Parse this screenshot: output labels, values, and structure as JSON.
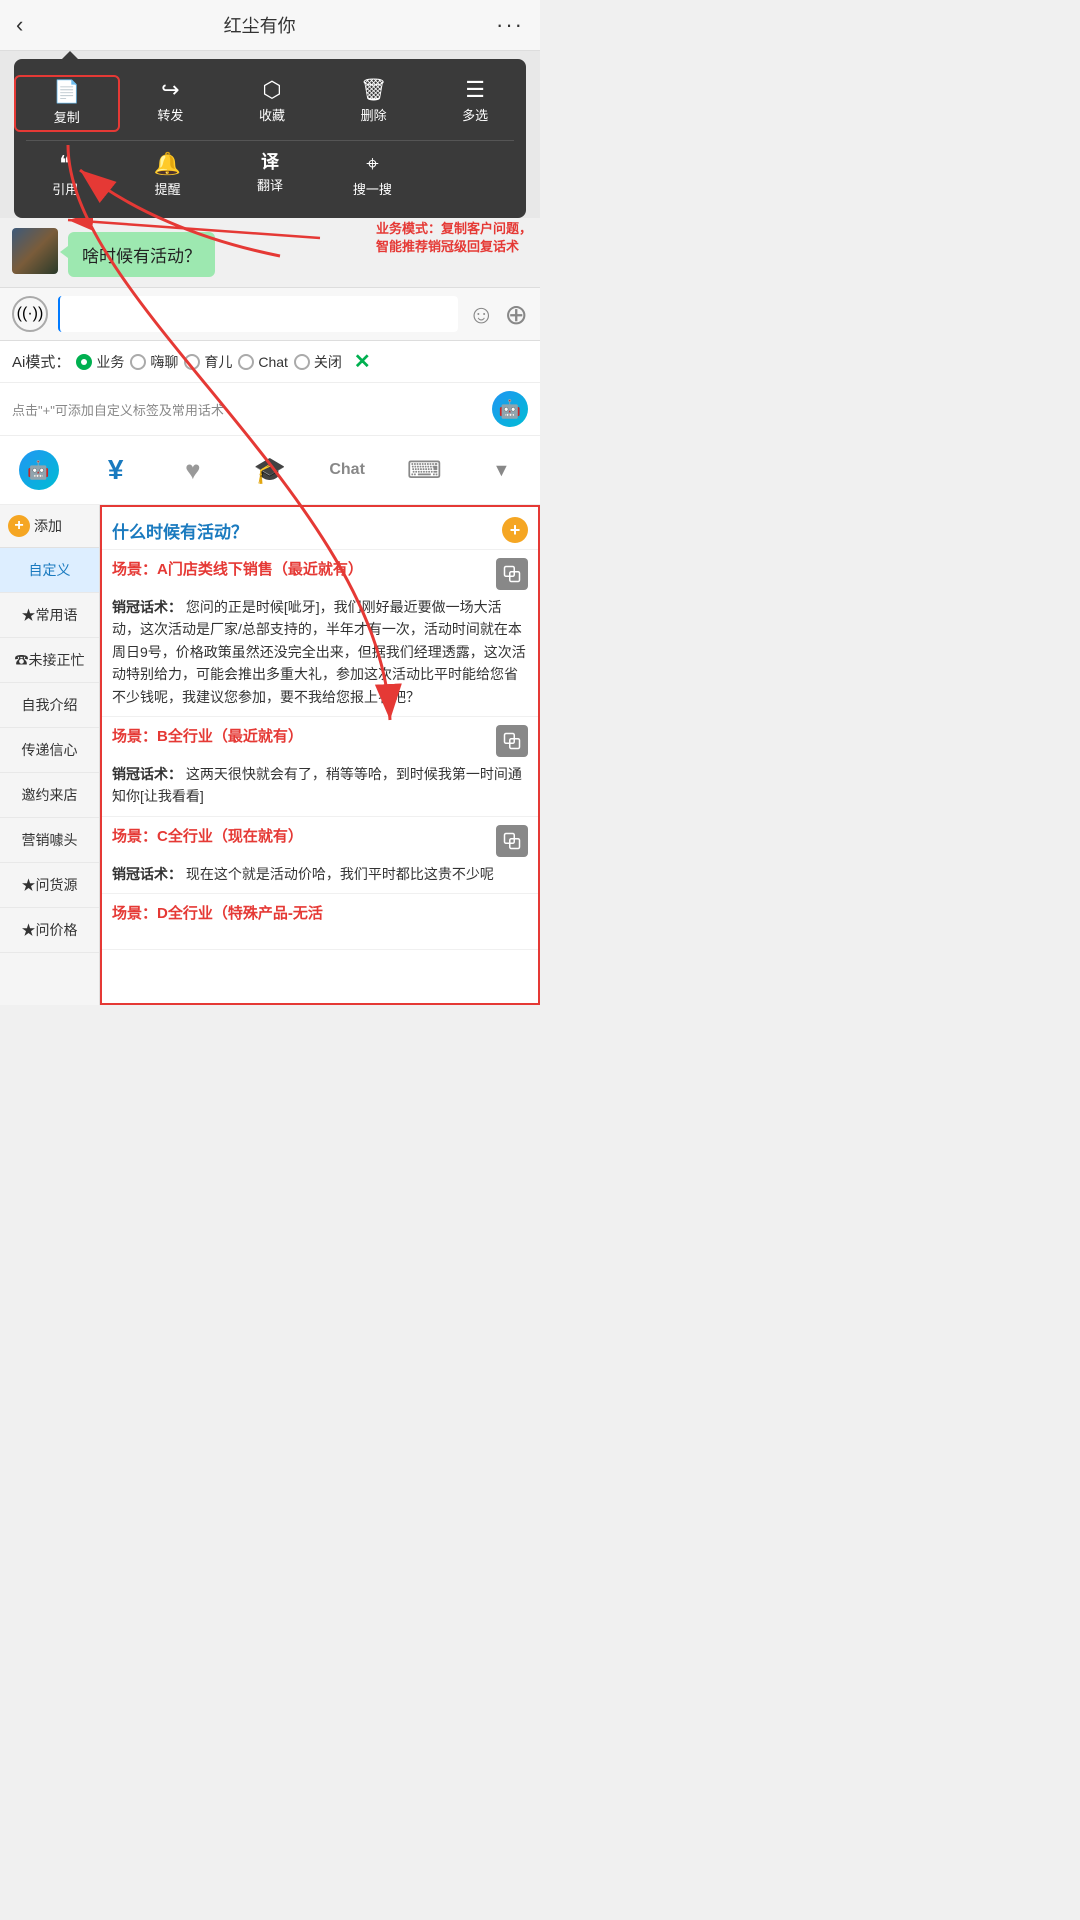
{
  "header": {
    "title": "红尘有你",
    "back_label": "‹",
    "more_label": "···"
  },
  "context_menu": {
    "row1": [
      {
        "icon": "📄",
        "label": "复制",
        "highlighted": true
      },
      {
        "icon": "↪",
        "label": "转发"
      },
      {
        "icon": "⬡",
        "label": "收藏"
      },
      {
        "icon": "🗑",
        "label": "删除"
      },
      {
        "icon": "☰",
        "label": "多选"
      }
    ],
    "row2": [
      {
        "icon": "❝",
        "label": "引用"
      },
      {
        "icon": "🔔",
        "label": "提醒"
      },
      {
        "icon": "翻",
        "label": "翻译"
      },
      {
        "icon": "⌖",
        "label": "搜一搜"
      }
    ]
  },
  "chat": {
    "bubble_text": "啥时候有活动？",
    "annotation": "业务模式：复制客户问题，\n智能推荐销冠级回复话术"
  },
  "input": {
    "placeholder": "",
    "voice_icon": "((·))",
    "emoji_icon": "☺",
    "add_icon": "+"
  },
  "ai_mode": {
    "label": "Ai模式：",
    "options": [
      {
        "label": "业务",
        "active": true
      },
      {
        "label": "嗨聊",
        "active": false
      },
      {
        "label": "育儿",
        "active": false
      },
      {
        "label": "Chat",
        "active": false
      },
      {
        "label": "关闭",
        "active": false
      }
    ],
    "close_icon": "✕"
  },
  "hint_bar": {
    "text": "点击\"+\"可添加自定义标签及常用话术"
  },
  "toolbar": {
    "items": [
      {
        "icon": "🤖",
        "type": "robot",
        "label": "chat-robot"
      },
      {
        "icon": "¥",
        "label": "yuan"
      },
      {
        "icon": "♥",
        "label": "heart"
      },
      {
        "icon": "🎓",
        "label": "graduation"
      },
      {
        "icon": "Chat",
        "label": "chat-text"
      },
      {
        "icon": "⌨",
        "label": "keyboard"
      },
      {
        "icon": "▼",
        "label": "more"
      }
    ]
  },
  "sidebar": {
    "add_label": "添加",
    "items": [
      {
        "label": "自定义",
        "active": true
      },
      {
        "label": "★常用语"
      },
      {
        "label": "☎未接正忙"
      },
      {
        "label": "自我介绍"
      },
      {
        "label": "传递信心"
      },
      {
        "label": "邀约来店"
      },
      {
        "label": "营销噱头"
      },
      {
        "label": "★问货源"
      },
      {
        "label": "★问价格"
      }
    ]
  },
  "content": {
    "question": "什么时候有活动？",
    "scenarios": [
      {
        "title": "场景：A门店类线下销售（最近就有）",
        "label": "销冠话术：",
        "text": "您问的正是时候[呲牙]，我们刚好最近要做一场大活动，这次活动是厂家/总部支持的，半年才有一次，活动时间就在本周日9号，价格政策虽然还没完全出来，但据我们经理透露，这次活动特别给力，可能会推出多重大礼，参加这次活动比平时能给您省不少钱呢，我建议您参加，要不我给您报上名吧？"
      },
      {
        "title": "场景：B全行业（最近就有）",
        "label": "销冠话术：",
        "text": "这两天很快就会有了，稍等等哈，到时候我第一时间通知你[让我看看]"
      },
      {
        "title": "场景：C全行业（现在就有）",
        "label": "销冠话术：",
        "text": "现在这个就是活动价哈，我们平时都比这贵不少呢"
      },
      {
        "title": "场景：D全行业（特殊产品-无活",
        "label": "",
        "text": ""
      }
    ]
  }
}
